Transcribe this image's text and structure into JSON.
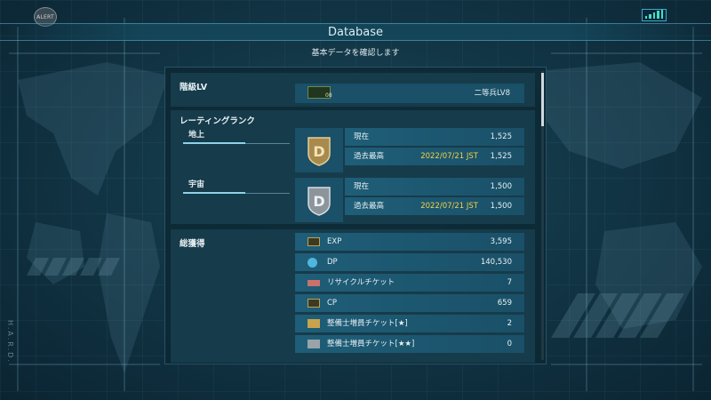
{
  "header": {
    "alert_label": "ALERT",
    "title": "Database",
    "subtitle": "基本データを確認します",
    "side_label": "H.A.R.D."
  },
  "level": {
    "title": "階級LV",
    "badge_number": "08",
    "value": "二等兵LV8"
  },
  "rating": {
    "title": "レーティングランク",
    "ground": {
      "tab": "地上",
      "rank_letter": "D",
      "current_label": "現在",
      "current_value": "1,525",
      "best_label": "過去最高",
      "best_date": "2022/07/21 JST",
      "best_value": "1,525"
    },
    "space": {
      "tab": "宇宙",
      "rank_letter": "D",
      "current_label": "現在",
      "current_value": "1,500",
      "best_label": "過去最高",
      "best_date": "2022/07/21 JST",
      "best_value": "1,500"
    }
  },
  "totals": {
    "title": "総獲得",
    "items": [
      {
        "icon": "exp-icon",
        "label": "EXP",
        "value": "3,595"
      },
      {
        "icon": "dp-icon",
        "label": "DP",
        "value": "140,530"
      },
      {
        "icon": "recycle-ticket-icon",
        "label": "リサイクルチケット",
        "value": "7"
      },
      {
        "icon": "cp-icon",
        "label": "CP",
        "value": "659"
      },
      {
        "icon": "mechanic-ticket-1star-icon",
        "label": "整備士増員チケット[★]",
        "value": "2"
      },
      {
        "icon": "mechanic-ticket-2star-icon",
        "label": "整備士増員チケット[★★]",
        "value": "0"
      }
    ]
  },
  "colors": {
    "accent": "#8fd1e6",
    "row_bg": "#1f5e78",
    "date_yellow": "#f2d24a",
    "signal": "#3ee0c8"
  }
}
